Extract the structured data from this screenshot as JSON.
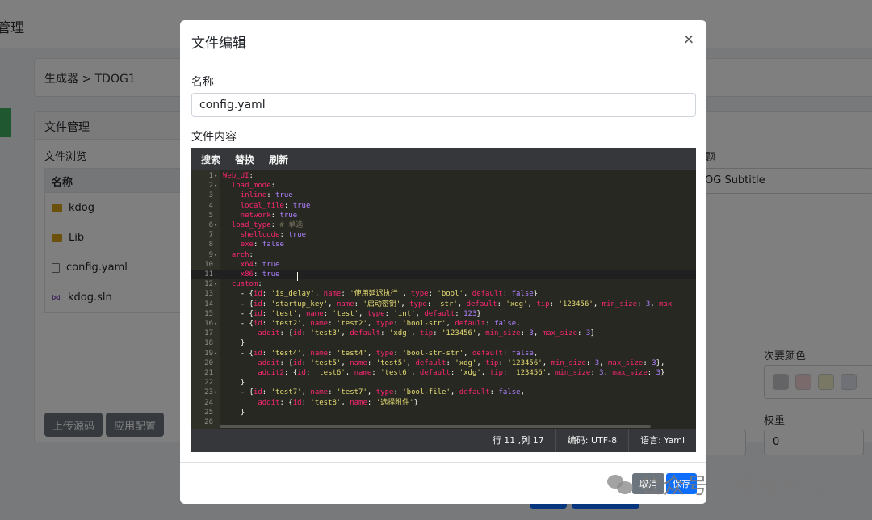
{
  "background": {
    "topbar_title": "管理",
    "breadcrumb": "生成器 > TDOG1",
    "file_manager": {
      "title": "文件管理",
      "browse_label": "文件浏览",
      "column_header": "名称",
      "items": [
        {
          "name": "kdog",
          "type": "folder"
        },
        {
          "name": "Lib",
          "type": "folder"
        },
        {
          "name": "config.yaml",
          "type": "file"
        },
        {
          "name": "kdog.sln",
          "type": "sln"
        }
      ],
      "upload_button": "上传源码",
      "apply_button": "应用配置"
    },
    "right_panel": {
      "title_fragment": "题",
      "subtitle_value": "OG Subtitle",
      "secondary_color_label": "次要颜色",
      "weight_label": "权重",
      "weight_value": "0",
      "swatch_colors": [
        "#c8c9cf",
        "#f5d5d8",
        "#f3f1c8",
        "#dfe3ec"
      ]
    }
  },
  "modal": {
    "title": "文件编辑",
    "close_symbol": "×",
    "name_label": "名称",
    "name_value": "config.yaml",
    "content_label": "文件内容",
    "toolbar": {
      "search": "搜索",
      "replace": "替换",
      "refresh": "刷新"
    },
    "code_lines": [
      "<span class='k'>Web_UI</span><span class='p'>:</span>",
      "  <span class='k'>load_mode</span><span class='p'>:</span>",
      "    <span class='k'>inline</span><span class='p'>: </span><span class='b'>true</span>",
      "    <span class='k'>local_file</span><span class='p'>: </span><span class='b'>true</span>",
      "    <span class='k'>network</span><span class='p'>: </span><span class='b'>true</span>",
      "  <span class='k'>load_type</span><span class='p'>: </span><span class='c'># 单选</span>",
      "    <span class='k'>shellcode</span><span class='p'>: </span><span class='b'>true</span>",
      "    <span class='k'>exe</span><span class='p'>: </span><span class='b'>false</span>",
      "  <span class='k'>arch</span><span class='p'>:</span>",
      "    <span class='k'>x64</span><span class='p'>: </span><span class='b'>true</span>",
      "    <span class='k'>x86</span><span class='p'>: </span><span class='b'>true</span>",
      "  <span class='k'>custom</span><span class='p'>:</span>",
      "    <span class='p'>- {</span><span class='k'>id</span><span class='p'>: </span><span class='s'>'is_delay'</span><span class='p'>, </span><span class='k'>name</span><span class='p'>: </span><span class='s'>'使用延迟执行'</span><span class='p'>, </span><span class='k'>type</span><span class='p'>: </span><span class='s'>'bool'</span><span class='p'>, </span><span class='k'>default</span><span class='p'>: </span><span class='b'>false</span><span class='p'>}</span>",
      "    <span class='p'>- {</span><span class='k'>id</span><span class='p'>: </span><span class='s'>'startup_key'</span><span class='p'>, </span><span class='k'>name</span><span class='p'>: </span><span class='s'>'启动密钥'</span><span class='p'>, </span><span class='k'>type</span><span class='p'>: </span><span class='s'>'str'</span><span class='p'>, </span><span class='k'>default</span><span class='p'>: </span><span class='s'>'xdg'</span><span class='p'>, </span><span class='k'>tip</span><span class='p'>: </span><span class='s'>'123456'</span><span class='p'>, </span><span class='k'>min_size</span><span class='p'>: </span><span class='b'>3</span><span class='p'>, </span><span class='k'>max</span>",
      "    <span class='p'>- {</span><span class='k'>id</span><span class='p'>: </span><span class='s'>'test'</span><span class='p'>, </span><span class='k'>name</span><span class='p'>: </span><span class='s'>'test'</span><span class='p'>, </span><span class='k'>type</span><span class='p'>: </span><span class='s'>'int'</span><span class='p'>, </span><span class='k'>default</span><span class='p'>: </span><span class='b'>123</span><span class='p'>}</span>",
      "    <span class='p'>- {</span><span class='k'>id</span><span class='p'>: </span><span class='s'>'test2'</span><span class='p'>, </span><span class='k'>name</span><span class='p'>: </span><span class='s'>'test2'</span><span class='p'>, </span><span class='k'>type</span><span class='p'>: </span><span class='s'>'bool-str'</span><span class='p'>, </span><span class='k'>default</span><span class='p'>: </span><span class='b'>false</span><span class='p'>,</span>",
      "        <span class='k'>addit</span><span class='p'>: {</span><span class='k'>id</span><span class='p'>: </span><span class='s'>'test3'</span><span class='p'>, </span><span class='k'>default</span><span class='p'>: </span><span class='s'>'xdg'</span><span class='p'>, </span><span class='k'>tip</span><span class='p'>: </span><span class='s'>'123456'</span><span class='p'>, </span><span class='k'>min_size</span><span class='p'>: </span><span class='b'>3</span><span class='p'>, </span><span class='k'>max_size</span><span class='p'>: </span><span class='b'>3</span><span class='p'>}</span>",
      "    <span class='p'>}</span>",
      "    <span class='p'>- {</span><span class='k'>id</span><span class='p'>: </span><span class='s'>'test4'</span><span class='p'>, </span><span class='k'>name</span><span class='p'>: </span><span class='s'>'test4'</span><span class='p'>, </span><span class='k'>type</span><span class='p'>: </span><span class='s'>'bool-str-str'</span><span class='p'>, </span><span class='k'>default</span><span class='p'>: </span><span class='b'>false</span><span class='p'>,</span>",
      "        <span class='k'>addit</span><span class='p'>: {</span><span class='k'>id</span><span class='p'>: </span><span class='s'>'test5'</span><span class='p'>, </span><span class='k'>name</span><span class='p'>: </span><span class='s'>'test5'</span><span class='p'>, </span><span class='k'>default</span><span class='p'>: </span><span class='s'>'xdg'</span><span class='p'>, </span><span class='k'>tip</span><span class='p'>: </span><span class='s'>'123456'</span><span class='p'>, </span><span class='k'>min_size</span><span class='p'>: </span><span class='b'>3</span><span class='p'>, </span><span class='k'>max_size</span><span class='p'>: </span><span class='b'>3</span><span class='p'>},</span>",
      "        <span class='k'>addit2</span><span class='p'>: {</span><span class='k'>id</span><span class='p'>: </span><span class='s'>'test6'</span><span class='p'>, </span><span class='k'>name</span><span class='p'>: </span><span class='s'>'test6'</span><span class='p'>, </span><span class='k'>default</span><span class='p'>: </span><span class='s'>'xdg'</span><span class='p'>, </span><span class='k'>tip</span><span class='p'>: </span><span class='s'>'123456'</span><span class='p'>, </span><span class='k'>min_size</span><span class='p'>: </span><span class='b'>3</span><span class='p'>, </span><span class='k'>max_size</span><span class='p'>: </span><span class='b'>3</span><span class='p'>}</span>",
      "    <span class='p'>}</span>",
      "    <span class='p'>- {</span><span class='k'>id</span><span class='p'>: </span><span class='s'>'test7'</span><span class='p'>, </span><span class='k'>name</span><span class='p'>: </span><span class='s'>'test7'</span><span class='p'>, </span><span class='k'>type</span><span class='p'>: </span><span class='s'>'bool-file'</span><span class='p'>, </span><span class='k'>default</span><span class='p'>: </span><span class='b'>false</span><span class='p'>,</span>",
      "        <span class='k'>addit</span><span class='p'>: {</span><span class='k'>id</span><span class='p'>: </span><span class='s'>'test8'</span><span class='p'>, </span><span class='k'>name</span><span class='p'>: </span><span class='s'>'选择附件'</span><span class='p'>}</span>",
      "    <span class='p'>}</span>",
      ""
    ],
    "fold_lines": [
      1,
      2,
      6,
      9,
      12,
      16,
      19,
      23
    ],
    "active_line": 11,
    "status": {
      "position": "行 11 ,列 17",
      "encoding": "编码: UTF-8",
      "language": "语言: Yaml"
    },
    "cancel_button": "取消",
    "save_button": "保存"
  },
  "watermark": "公众号 · 锦鲤安全"
}
